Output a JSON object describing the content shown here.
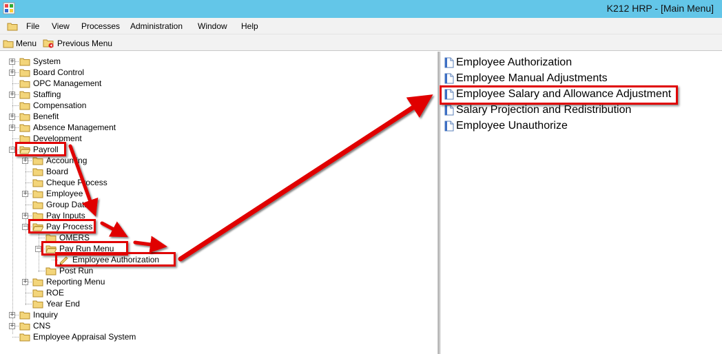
{
  "window": {
    "title": "K212 HRP - [Main Menu]"
  },
  "menubar": {
    "items": [
      "File",
      "View",
      "Processes",
      "Administration",
      "Window",
      "Help"
    ]
  },
  "toolbar": {
    "menu_label": "Menu",
    "previous_menu_label": "Previous Menu"
  },
  "tree": {
    "nodes": [
      {
        "label": "System",
        "expander": "+"
      },
      {
        "label": "Board Control",
        "expander": "+"
      },
      {
        "label": "OPC Management",
        "expander": ""
      },
      {
        "label": "Staffing",
        "expander": "+"
      },
      {
        "label": "Compensation",
        "expander": ""
      },
      {
        "label": "Benefit",
        "expander": "+"
      },
      {
        "label": "Absence Management",
        "expander": "+"
      },
      {
        "label": "Development",
        "expander": ""
      },
      {
        "label": "Payroll",
        "expander": "-"
      },
      {
        "label": "Accounting",
        "expander": "+"
      },
      {
        "label": "Board",
        "expander": ""
      },
      {
        "label": "Cheque Process",
        "expander": ""
      },
      {
        "label": "Employee",
        "expander": "+"
      },
      {
        "label": "Group Data",
        "expander": ""
      },
      {
        "label": "Pay Inputs",
        "expander": "+"
      },
      {
        "label": "Pay Process",
        "expander": "-"
      },
      {
        "label": "OMERS",
        "expander": ""
      },
      {
        "label": "Pay Run Menu",
        "expander": "-"
      },
      {
        "label": "Employee Authorization",
        "expander": ""
      },
      {
        "label": "Post Run",
        "expander": ""
      },
      {
        "label": "Reporting Menu",
        "expander": "+"
      },
      {
        "label": "ROE",
        "expander": ""
      },
      {
        "label": "Year End",
        "expander": ""
      },
      {
        "label": "Inquiry",
        "expander": "+"
      },
      {
        "label": "CNS",
        "expander": "+"
      },
      {
        "label": "Employee Appraisal System",
        "expander": ""
      }
    ]
  },
  "list": {
    "items": [
      "Employee Authorization",
      "Employee Manual Adjustments",
      "Employee Salary and Allowance Adjustment",
      "Salary Projection and Redistribution",
      "Employee Unauthorize"
    ]
  },
  "colors": {
    "titlebar": "#63c6e8",
    "annotation": "#e00000",
    "folder": "#f3d57a"
  }
}
